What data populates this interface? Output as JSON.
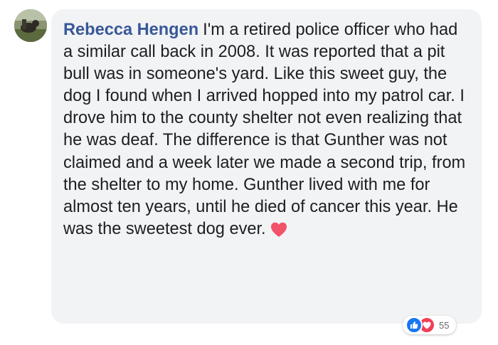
{
  "comment": {
    "author": "Rebecca Hengen",
    "text": "I'm a retired police officer who had a similar call back in 2008. It was reported that a pit bull was in someone's yard. Like this sweet guy, the dog I found when I arrived hopped into my patrol car. I drove him to the county shelter not even realizing that he was deaf. The difference is that Gunther was not claimed and a week later we made a second trip, from the shelter to my home. Gunther lived with me for almost ten years, until he died of cancer this year. He was the sweetest dog ever.",
    "inline_emoji": "heart-icon"
  },
  "reactions": {
    "icons": [
      "like-icon",
      "love-icon"
    ],
    "count": "55"
  },
  "colors": {
    "author": "#385898",
    "bubble_bg": "#f2f3f5",
    "text": "#1c1e21",
    "like": "#1877f2",
    "love": "#f33e58",
    "heart_emoji": "#f25268"
  }
}
